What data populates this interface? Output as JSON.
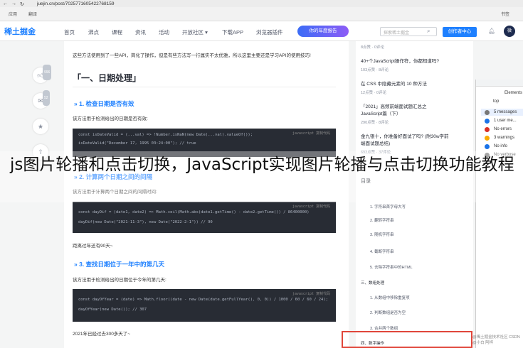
{
  "browser": {
    "url": "juejin.cn/post/7025771605422768159",
    "bookmarks": [
      "应用",
      "翻译",
      "书签"
    ]
  },
  "site": {
    "logo": "稀土掘金",
    "nav": [
      "首页",
      "沸点",
      "课程",
      "资讯",
      "活动",
      "开放社区 ▾",
      "下载APP",
      "浏览器插件"
    ],
    "promo": "你的年度报告",
    "search_placeholder": "探索稀土掘金",
    "creator_button": "创作者中心",
    "avatar_text": "微"
  },
  "article": {
    "intro": "这些方法使用到了一些API，简化了操作，但是有些方法写一行属实不太优雅，所以这里主要还是学习API的使用技巧!",
    "section_title": "「一、日期处理」",
    "items": [
      {
        "heading": "» 1. 检查日期是否有效",
        "desc": "该方法用于检测给出的日期是否有效:",
        "code": [
          "const isDateValid = (...val) => !Number.isNaN(new Date(...val).valueOf());",
          "",
          "isDateValid(\"December 17, 1995 03:24:00\"); // true"
        ],
        "lang": "javascript 复制代码"
      },
      {
        "heading": "» 2. 计算两个日期之间的间隔",
        "desc": "该方法用于计算两个日期之间的间隔时间:",
        "code": [
          "const dayDif = (date1, date2) => Math.ceil(Math.abs(date1.getTime() - date2.getTime()) / 86400000)",
          "",
          "dayDif(new Date(\"2021-11-3\"), new Date(\"2022-2-1\"))  // 90"
        ],
        "lang": "javascript 复制代码",
        "after": "距离过年还有90天~"
      },
      {
        "heading": "» 3. 查找日期位于一年中的第几天",
        "desc": "该方法用于检测给出的日期位于今年的第几天:",
        "code": [
          "const dayOfYear = (date) => Math.floor((date - new Date(date.getFullYear(), 0, 0)) / 1000 / 60 / 60 / 24);",
          "",
          "dayOfYear(new Date());   // 307"
        ],
        "lang": "javascript 复制代码",
        "after": "2021年已经过去300多天了~"
      }
    ],
    "side_counts": [
      "996",
      "52"
    ]
  },
  "sidebar": {
    "articles": [
      {
        "meta": "8点赞 · 0评论"
      },
      {
        "title": "40+个JavaScript操作符，你都知道吗?",
        "meta": "103点赞 · 8评论"
      },
      {
        "title": "在 CSS 中隐藏元素的 10 种方法",
        "meta": "12点赞 · 0评论"
      },
      {
        "title": "「2021」高频前端面试题汇总之JavaScript篇（下）",
        "meta": "290点赞 · 8评论"
      },
      {
        "title": "金九银十，你准备好面试了吗? (附30w字前端面试题总结)",
        "meta": "693点赞 · 37评论"
      }
    ],
    "toc_title": "目录",
    "toc": [
      "1. 字符串首字母大写",
      "2. 翻转字符串",
      "3. 随机字符串",
      "4. 截断字符串",
      "5. 去除字符串中的HTML",
      "三、数组处理",
      "1. 从数组中移除重复项",
      "2. 判断数组是否为空",
      "3. 合并两个数组",
      "四、数字操作"
    ]
  },
  "devtools": {
    "tab": "Elements",
    "context": "top",
    "items": [
      "5 messages",
      "1 user me...",
      "No errors",
      "3 warnings",
      "No info",
      "No verbose"
    ]
  },
  "caption": "js图片轮播和点击切换，JavaScript实现图片轮播与点击切换功能教程",
  "watermark": "@稀土掘金技术社区 CSDN @小白 阿梓"
}
